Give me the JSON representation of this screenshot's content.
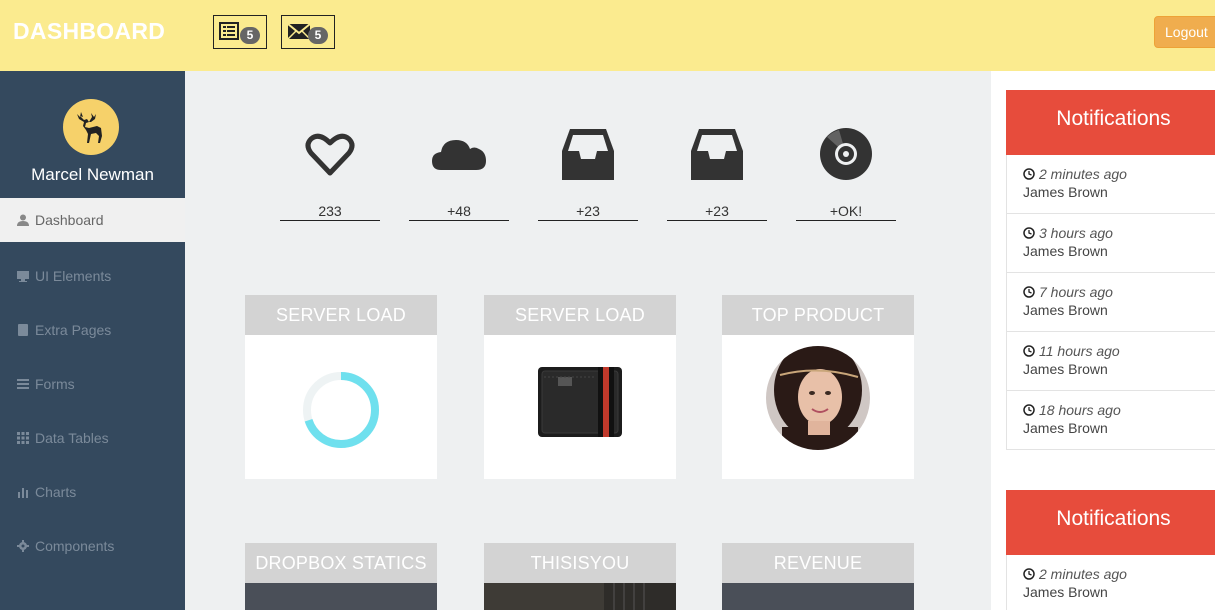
{
  "header": {
    "brand": "DASHBOARD",
    "tasks_badge": "5",
    "mail_badge": "5",
    "logout_label": "Logout"
  },
  "sidebar": {
    "user_name": "Marcel Newman",
    "items": [
      {
        "label": "Dashboard",
        "icon": "user-icon",
        "active": true
      },
      {
        "label": "UI Elements",
        "icon": "monitor-icon"
      },
      {
        "label": "Extra Pages",
        "icon": "book-icon"
      },
      {
        "label": "Forms",
        "icon": "list-icon"
      },
      {
        "label": "Data Tables",
        "icon": "grid-icon"
      },
      {
        "label": "Charts",
        "icon": "bar-chart-icon"
      },
      {
        "label": "Components",
        "icon": "cog-icon"
      }
    ]
  },
  "stats": [
    {
      "icon": "heart-icon",
      "value": "233"
    },
    {
      "icon": "cloud-icon",
      "value": "+48"
    },
    {
      "icon": "inbox-icon",
      "value": "+23"
    },
    {
      "icon": "inbox-icon",
      "value": "+23"
    },
    {
      "icon": "vinyl-icon",
      "value": "+OK!"
    }
  ],
  "panels": [
    {
      "title": "SERVER LOAD",
      "content": "donut-chart",
      "load_fraction": 0.7
    },
    {
      "title": "SERVER LOAD",
      "content": "wallet-image"
    },
    {
      "title": "TOP PRODUCT",
      "content": "profile-photo"
    },
    {
      "title": "DROPBOX STATICS"
    },
    {
      "title": "THISISYOU"
    },
    {
      "title": "REVENUE"
    }
  ],
  "notifications": {
    "title": "Notifications",
    "items": [
      {
        "time": "2 minutes ago",
        "name": "James Brown"
      },
      {
        "time": "3 hours ago",
        "name": "James Brown"
      },
      {
        "time": "7 hours ago",
        "name": "James Brown"
      },
      {
        "time": "11 hours ago",
        "name": "James Brown"
      },
      {
        "time": "18 hours ago",
        "name": "James Brown"
      }
    ],
    "second_title": "Notifications",
    "second_items": [
      {
        "time": "2 minutes ago",
        "name": "James Brown"
      }
    ]
  },
  "colors": {
    "header_bg": "#fbeb8f",
    "sidebar_bg": "#34495e",
    "notif_red": "#e74c3c",
    "donut_cyan": "#6fe0ee",
    "logout_orange": "#f0ad4e"
  }
}
